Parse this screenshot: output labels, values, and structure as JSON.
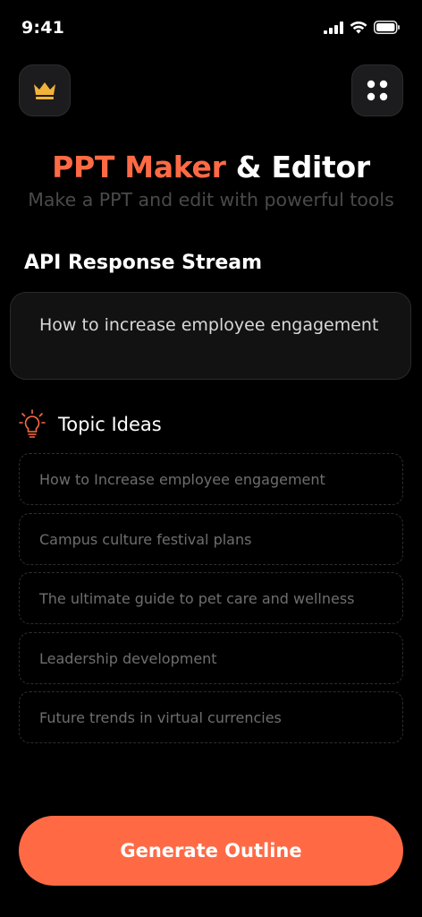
{
  "status_bar": {
    "time": "9:41"
  },
  "header": {
    "premium_icon": "crown-icon",
    "menu_icon": "grid-dots-icon",
    "title_accent": "PPT Maker",
    "title_rest": " & Editor",
    "subtitle": "Make a PPT and edit with powerful tools"
  },
  "prompt_section": {
    "title": "API Response Stream",
    "text": "How to increase employee engagement"
  },
  "ideas": {
    "icon": "lightbulb-icon",
    "label": "Topic Ideas",
    "items": [
      "How to Increase employee engagement",
      "Campus culture festival plans",
      "The ultimate guide to pet care and wellness",
      "Leadership development",
      "Future trends in virtual currencies"
    ]
  },
  "actions": {
    "generate_label": "Generate Outline"
  },
  "colors": {
    "accent": "#ff6a45",
    "crown": "#f2b23a",
    "background": "#000000"
  }
}
